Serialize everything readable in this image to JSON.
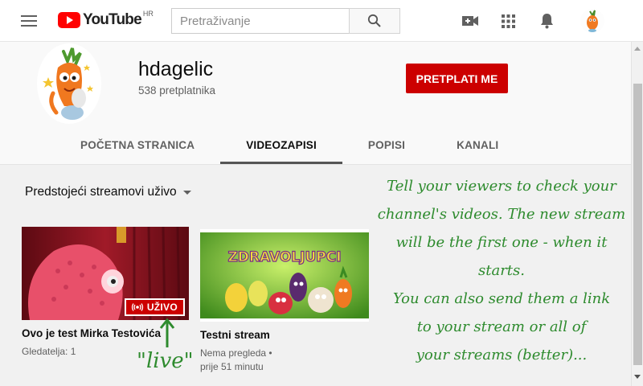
{
  "header": {
    "logo_text": "YouTube",
    "region": "HR",
    "search_placeholder": "Pretraživanje",
    "icons": [
      "menu-icon",
      "search-icon",
      "video-camera-icon",
      "apps-icon",
      "bell-icon"
    ]
  },
  "channel": {
    "name": "hdagelic",
    "subscribers": "538 pretplatnika",
    "subscribe_label": "PRETPLATI ME"
  },
  "tabs": [
    {
      "label": "POČETNA STRANICA",
      "active": false
    },
    {
      "label": "VIDEOZAPISI",
      "active": true
    },
    {
      "label": "POPISI",
      "active": false
    },
    {
      "label": "KANALI",
      "active": false
    }
  ],
  "section": {
    "title": "Predstojeći streamovi uživo"
  },
  "videos": [
    {
      "title": "Ovo je test Mirka Testovića",
      "meta_line1": "Gledatelja: 1",
      "meta_line2": "",
      "badge": "UŽIVO"
    },
    {
      "title": "Testni stream",
      "meta_line1": "Nema pregleda •",
      "meta_line2": "prije 51 minutu",
      "thumb_text": "ZDRAVOLJUPCI"
    }
  ],
  "annotations": {
    "lines": [
      "Tell your viewers to check your",
      "channel's videos. The new stream",
      "will be the first one - when it",
      "starts.",
      "You can also send them a link",
      "to your stream or all of",
      "your streams (better)..."
    ],
    "live_note": "\"live\""
  },
  "colors": {
    "brand_red": "#ff0000",
    "subscribe_red": "#cc0000",
    "annotation_green": "#2e8b2e"
  }
}
